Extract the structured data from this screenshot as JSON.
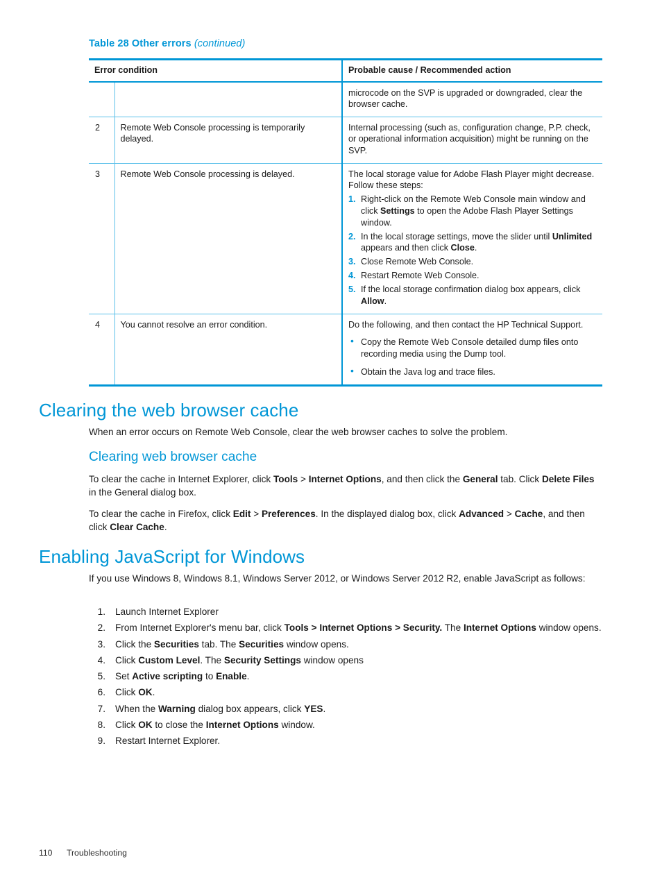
{
  "table": {
    "caption_label": "Table 28 Other errors",
    "caption_continued": "(continued)",
    "headers": {
      "col1": "Error condition",
      "col2": "Probable cause / Recommended action"
    },
    "rows": [
      {
        "num": "",
        "condition": "",
        "cause_intro": "microcode on the SVP is upgraded or downgraded, clear the browser cache."
      },
      {
        "num": "2",
        "condition": "Remote Web Console processing is temporarily delayed.",
        "cause_intro": "Internal processing (such as, configuration change, P.P. check, or operational information acquisition) might be running on the SVP."
      },
      {
        "num": "3",
        "condition": "Remote Web Console processing is delayed.",
        "cause_intro": "The local storage value for Adobe Flash Player might decrease. Follow these steps:",
        "steps": [
          {
            "num": "1.",
            "pre": "Right-click on the Remote Web Console main window and click ",
            "bold1": "Settings",
            "mid": " to open the Adobe Flash Player Settings window.",
            "bold2": "",
            "post": ""
          },
          {
            "num": "2.",
            "pre": "In the local storage settings, move the slider until ",
            "bold1": "Unlimited",
            "mid": " appears and then click ",
            "bold2": "Close",
            "post": "."
          },
          {
            "num": "3.",
            "pre": "Close Remote Web Console.",
            "bold1": "",
            "mid": "",
            "bold2": "",
            "post": ""
          },
          {
            "num": "4.",
            "pre": "Restart Remote Web Console.",
            "bold1": "",
            "mid": "",
            "bold2": "",
            "post": ""
          },
          {
            "num": "5.",
            "pre": "If the local storage confirmation dialog box appears, click ",
            "bold1": "Allow",
            "mid": ".",
            "bold2": "",
            "post": ""
          }
        ]
      },
      {
        "num": "4",
        "condition": "You cannot resolve an error condition.",
        "cause_intro": "Do the following, and then contact the HP Technical Support.",
        "bullets": [
          "Copy the Remote Web Console detailed dump files onto recording media using the Dump tool.",
          "Obtain the Java log and trace files."
        ]
      }
    ]
  },
  "section_cache": {
    "heading": "Clearing the web browser cache",
    "intro": "When an error occurs on Remote Web Console, clear the web browser caches to solve the problem.",
    "subheading": "Clearing web browser cache",
    "para_ie": {
      "t1": "To clear the cache in Internet Explorer, click ",
      "b1": "Tools",
      "t2": " > ",
      "b2": "Internet Options",
      "t3": ", and then click the ",
      "b3": "General",
      "t4": " tab. Click ",
      "b4": "Delete Files",
      "t5": " in the General dialog box."
    },
    "para_ff": {
      "t1": "To clear the cache in Firefox, click ",
      "b1": "Edit",
      "t2": " > ",
      "b2": "Preferences",
      "t3": ". In the displayed dialog box, click ",
      "b3": "Advanced",
      "t4": " > ",
      "b4": "Cache",
      "t5": ", and then click ",
      "b5": "Clear Cache",
      "t6": "."
    }
  },
  "section_js": {
    "heading": "Enabling JavaScript for Windows",
    "intro": "If you use Windows 8, Windows 8.1, Windows Server 2012, or Windows Server 2012 R2, enable JavaScript as follows:",
    "steps": [
      {
        "num": "1.",
        "t1": "Launch Internet Explorer",
        "b1": "",
        "t2": "",
        "b2": "",
        "t3": ""
      },
      {
        "num": "2.",
        "t1": "From Internet Explorer's menu bar, click ",
        "b1": "Tools > Internet Options > Security.",
        "t2": " The ",
        "b2": "Internet Options",
        "t3": " window opens."
      },
      {
        "num": "3.",
        "t1": "Click the ",
        "b1": "Securities",
        "t2": " tab. The ",
        "b2": "Securities",
        "t3": " window opens."
      },
      {
        "num": "4.",
        "t1": "Click ",
        "b1": "Custom Level",
        "t2": ". The ",
        "b2": "Security Settings",
        "t3": " window opens"
      },
      {
        "num": "5.",
        "t1": "Set ",
        "b1": "Active scripting",
        "t2": " to ",
        "b2": "Enable",
        "t3": "."
      },
      {
        "num": "6.",
        "t1": "Click ",
        "b1": "OK",
        "t2": ".",
        "b2": "",
        "t3": ""
      },
      {
        "num": "7.",
        "t1": "When the ",
        "b1": "Warning",
        "t2": " dialog box appears, click ",
        "b2": "YES",
        "t3": "."
      },
      {
        "num": "8.",
        "t1": "Click ",
        "b1": "OK",
        "t2": " to close the ",
        "b2": "Internet Options",
        "t3": " window."
      },
      {
        "num": "9.",
        "t1": "Restart Internet Explorer.",
        "b1": "",
        "t2": "",
        "b2": "",
        "t3": ""
      }
    ]
  },
  "footer": {
    "page_number": "110",
    "chapter": "Troubleshooting"
  },
  "colors": {
    "accent_blue": "#0096d6",
    "rule_light_blue": "#5bc0ea",
    "text": "#1a1a1a"
  }
}
